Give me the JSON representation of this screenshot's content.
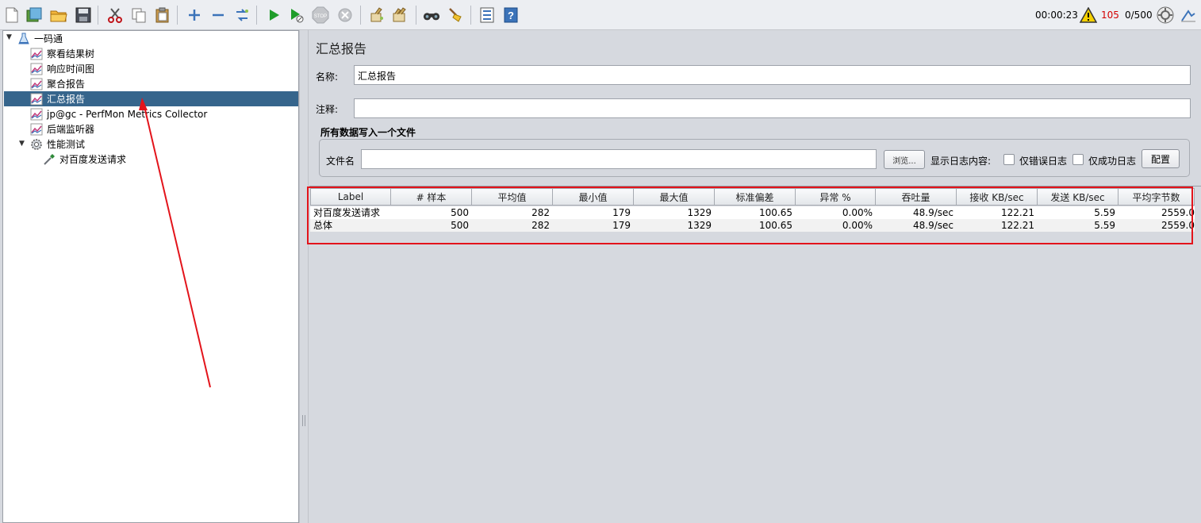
{
  "toolbar": {
    "timer": "00:00:23",
    "warning_count": "105",
    "thread_count": "0/500",
    "colors": {
      "warning": "#d40000",
      "run": "#1f9d2a",
      "accent": "#3b73b9"
    }
  },
  "tree": {
    "root": "一码通",
    "items": [
      "察看结果树",
      "响应时间图",
      "聚合报告",
      "汇总报告",
      "jp@gc - PerfMon Metrics Collector",
      "后端监听器"
    ],
    "group": "性能测试",
    "sampler": "对百度发送请求",
    "selected_color": "#36658c"
  },
  "panel": {
    "title": "汇总报告",
    "name_label": "名称:",
    "name_value": "汇总报告",
    "comment_label": "注释:",
    "comment_value": "",
    "file_group_title": "所有数据写入一个文件",
    "file_label": "文件名",
    "file_value": "",
    "browse_button": "浏览...",
    "log_content_label": "显示日志内容:",
    "errors_only_label": "仅错误日志",
    "success_only_label": "仅成功日志",
    "configure_button": "配置"
  },
  "table": {
    "headers": [
      "Label",
      "# 样本",
      "平均值",
      "最小值",
      "最大值",
      "标准偏差",
      "异常 %",
      "吞吐量",
      "接收 KB/sec",
      "发送 KB/sec",
      "平均字节数"
    ],
    "rows": [
      [
        "对百度发送请求",
        "500",
        "282",
        "179",
        "1329",
        "100.65",
        "0.00%",
        "48.9/sec",
        "122.21",
        "5.59",
        "2559.0"
      ],
      [
        "总体",
        "500",
        "282",
        "179",
        "1329",
        "100.65",
        "0.00%",
        "48.9/sec",
        "122.21",
        "5.59",
        "2559.0"
      ]
    ],
    "highlight_color": "#e3141b"
  }
}
